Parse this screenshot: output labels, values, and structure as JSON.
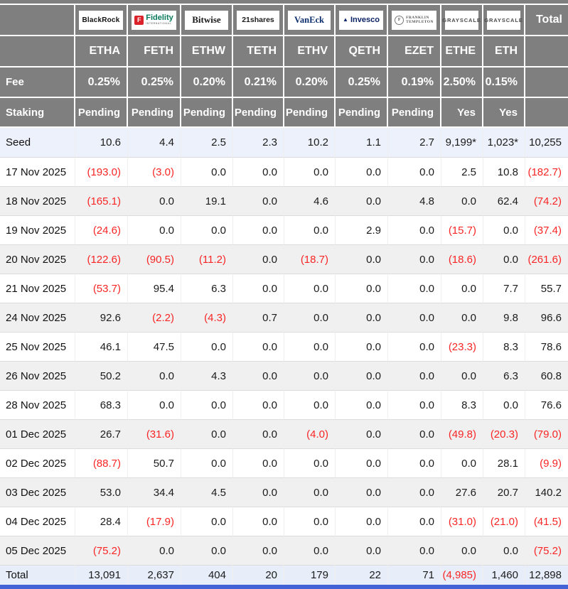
{
  "table": {
    "total_header": "Total",
    "fee_label": "Fee",
    "staking_label": "Staking",
    "providers": [
      {
        "brand": "BlackRock",
        "logo": "blackrock",
        "ticker": "ETHA",
        "fee": "0.25%",
        "staking": "Pending"
      },
      {
        "brand": "Fidelity",
        "sub": "INTERNATIONAL",
        "logo": "fidelity",
        "ticker": "FETH",
        "fee": "0.25%",
        "staking": "Pending"
      },
      {
        "brand": "Bitwise",
        "logo": "bitwise",
        "ticker": "ETHW",
        "fee": "0.20%",
        "staking": "Pending"
      },
      {
        "brand": "21shares",
        "logo": "shares21",
        "ticker": "TETH",
        "fee": "0.21%",
        "staking": "Pending"
      },
      {
        "brand": "VanEck",
        "logo": "vaneck",
        "ticker": "ETHV",
        "fee": "0.20%",
        "staking": "Pending"
      },
      {
        "brand": "Invesco",
        "logo": "invesco",
        "ticker": "QETH",
        "fee": "0.25%",
        "staking": "Pending"
      },
      {
        "brand": "FRANKLIN TEMPLETON",
        "logo": "franklin",
        "ticker": "EZET",
        "fee": "0.19%",
        "staking": "Pending"
      },
      {
        "brand": "GRAYSCALE",
        "logo": "grayscale",
        "ticker": "ETHE",
        "fee": "2.50%",
        "staking": "Yes"
      },
      {
        "brand": "GRAYSCALE",
        "logo": "grayscale",
        "ticker": "ETH",
        "fee": "0.15%",
        "staking": "Yes"
      }
    ],
    "rows": [
      {
        "label": "Seed",
        "style": "seed",
        "values": [
          "10.6",
          "4.4",
          "2.5",
          "2.3",
          "10.2",
          "1.1",
          "2.7",
          "9,199*",
          "1,023*",
          "10,255"
        ]
      },
      {
        "label": "17 Nov 2025",
        "values": [
          "(193.0)",
          "(3.0)",
          "0.0",
          "0.0",
          "0.0",
          "0.0",
          "0.0",
          "2.5",
          "10.8",
          "(182.7)"
        ]
      },
      {
        "label": "18 Nov 2025",
        "values": [
          "(165.1)",
          "0.0",
          "19.1",
          "0.0",
          "4.6",
          "0.0",
          "4.8",
          "0.0",
          "62.4",
          "(74.2)"
        ]
      },
      {
        "label": "19 Nov 2025",
        "values": [
          "(24.6)",
          "0.0",
          "0.0",
          "0.0",
          "0.0",
          "2.9",
          "0.0",
          "(15.7)",
          "0.0",
          "(37.4)"
        ]
      },
      {
        "label": "20 Nov 2025",
        "values": [
          "(122.6)",
          "(90.5)",
          "(11.2)",
          "0.0",
          "(18.7)",
          "0.0",
          "0.0",
          "(18.6)",
          "0.0",
          "(261.6)"
        ]
      },
      {
        "label": "21 Nov 2025",
        "values": [
          "(53.7)",
          "95.4",
          "6.3",
          "0.0",
          "0.0",
          "0.0",
          "0.0",
          "0.0",
          "7.7",
          "55.7"
        ]
      },
      {
        "label": "24 Nov 2025",
        "values": [
          "92.6",
          "(2.2)",
          "(4.3)",
          "0.7",
          "0.0",
          "0.0",
          "0.0",
          "0.0",
          "9.8",
          "96.6"
        ]
      },
      {
        "label": "25 Nov 2025",
        "values": [
          "46.1",
          "47.5",
          "0.0",
          "0.0",
          "0.0",
          "0.0",
          "0.0",
          "(23.3)",
          "8.3",
          "78.6"
        ]
      },
      {
        "label": "26 Nov 2025",
        "values": [
          "50.2",
          "0.0",
          "4.3",
          "0.0",
          "0.0",
          "0.0",
          "0.0",
          "0.0",
          "6.3",
          "60.8"
        ]
      },
      {
        "label": "28 Nov 2025",
        "values": [
          "68.3",
          "0.0",
          "0.0",
          "0.0",
          "0.0",
          "0.0",
          "0.0",
          "8.3",
          "0.0",
          "76.6"
        ]
      },
      {
        "label": "01 Dec 2025",
        "values": [
          "26.7",
          "(31.6)",
          "0.0",
          "0.0",
          "(4.0)",
          "0.0",
          "0.0",
          "(49.8)",
          "(20.3)",
          "(79.0)"
        ]
      },
      {
        "label": "02 Dec 2025",
        "values": [
          "(88.7)",
          "50.7",
          "0.0",
          "0.0",
          "0.0",
          "0.0",
          "0.0",
          "0.0",
          "28.1",
          "(9.9)"
        ]
      },
      {
        "label": "03 Dec 2025",
        "values": [
          "53.0",
          "34.4",
          "4.5",
          "0.0",
          "0.0",
          "0.0",
          "0.0",
          "27.6",
          "20.7",
          "140.2"
        ]
      },
      {
        "label": "04 Dec 2025",
        "values": [
          "28.4",
          "(17.9)",
          "0.0",
          "0.0",
          "0.0",
          "0.0",
          "0.0",
          "(31.0)",
          "(21.0)",
          "(41.5)"
        ]
      },
      {
        "label": "05 Dec 2025",
        "values": [
          "(75.2)",
          "0.0",
          "0.0",
          "0.0",
          "0.0",
          "0.0",
          "0.0",
          "0.0",
          "0.0",
          "(75.2)"
        ]
      },
      {
        "label": "Total",
        "style": "total",
        "values": [
          "13,091",
          "2,637",
          "404",
          "20",
          "179",
          "22",
          "71",
          "(4,985)",
          "1,460",
          "12,898"
        ]
      }
    ]
  },
  "colors": {
    "header_bg": "#7f7f7f",
    "negative": "#f92525",
    "alt_row": "#f0f0f0",
    "seed_row": "#edf1fb",
    "total_row": "#e7eefa",
    "bottom_bar": "#4262d6"
  }
}
